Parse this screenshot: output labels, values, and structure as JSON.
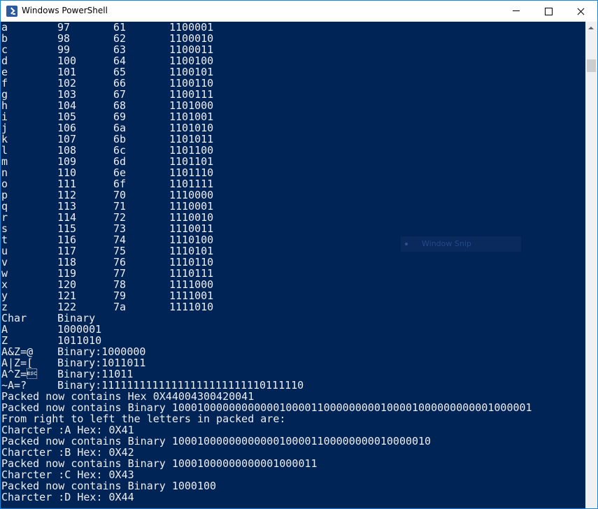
{
  "window": {
    "title": "Windows PowerShell"
  },
  "controls": {
    "minimize": "minimize",
    "maximize": "maximize",
    "close": "close"
  },
  "ascii_table": [
    [
      "a",
      "97",
      "61",
      "1100001"
    ],
    [
      "b",
      "98",
      "62",
      "1100010"
    ],
    [
      "c",
      "99",
      "63",
      "1100011"
    ],
    [
      "d",
      "100",
      "64",
      "1100100"
    ],
    [
      "e",
      "101",
      "65",
      "1100101"
    ],
    [
      "f",
      "102",
      "66",
      "1100110"
    ],
    [
      "g",
      "103",
      "67",
      "1100111"
    ],
    [
      "h",
      "104",
      "68",
      "1101000"
    ],
    [
      "i",
      "105",
      "69",
      "1101001"
    ],
    [
      "j",
      "106",
      "6a",
      "1101010"
    ],
    [
      "k",
      "107",
      "6b",
      "1101011"
    ],
    [
      "l",
      "108",
      "6c",
      "1101100"
    ],
    [
      "m",
      "109",
      "6d",
      "1101101"
    ],
    [
      "n",
      "110",
      "6e",
      "1101110"
    ],
    [
      "o",
      "111",
      "6f",
      "1101111"
    ],
    [
      "p",
      "112",
      "70",
      "1110000"
    ],
    [
      "q",
      "113",
      "71",
      "1110001"
    ],
    [
      "r",
      "114",
      "72",
      "1110010"
    ],
    [
      "s",
      "115",
      "73",
      "1110011"
    ],
    [
      "t",
      "116",
      "74",
      "1110100"
    ],
    [
      "u",
      "117",
      "75",
      "1110101"
    ],
    [
      "v",
      "118",
      "76",
      "1110110"
    ],
    [
      "w",
      "119",
      "77",
      "1110111"
    ],
    [
      "x",
      "120",
      "78",
      "1111000"
    ],
    [
      "y",
      "121",
      "79",
      "1111001"
    ],
    [
      "z",
      "122",
      "7a",
      "1111010"
    ]
  ],
  "binary_table": [
    [
      "Char",
      "Binary"
    ],
    [
      "A",
      "1000001"
    ],
    [
      "Z",
      "1011010"
    ],
    [
      "A&Z=@",
      "Binary:1000000"
    ],
    [
      "A|Z=[",
      "Binary:1011011"
    ],
    [
      "A^Z=\u001b",
      "Binary:11011"
    ],
    [
      "~A=?",
      "Binary:11111111111111111111111110111110"
    ]
  ],
  "output_lines": [
    "Packed now contains Hex 0X44004300420041",
    "Packed now contains Binary 100010000000000001000011000000000100001000000000001000001",
    "From right to left the letters in packed are:",
    "Charcter :A Hex: 0X41",
    "Packed now contains Binary 10001000000000000100001100000000010000010",
    "Charcter :B Hex: 0X42",
    "Packed now contains Binary 10001000000000001000011",
    "Charcter :C Hex: 0X43",
    "Packed now contains Binary 1000100",
    "Charcter :D Hex: 0X44"
  ],
  "overlay": {
    "label": "Window Snip"
  },
  "colors": {
    "console_bg": "#012456",
    "console_fg": "#eeedf0"
  }
}
